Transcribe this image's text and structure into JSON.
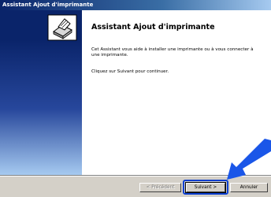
{
  "window": {
    "title": "Assistant Ajout d'imprimante"
  },
  "wizard": {
    "heading": "Assistant Ajout d'imprimante",
    "description": "Cet Assistant vous aide à installer une imprimante ou à vous connecter à une imprimante.",
    "instruction": "Cliquez sur Suivant pour continuer."
  },
  "buttons": {
    "back_label": "< Précédent",
    "next_label": "Suivant >",
    "cancel_label": "Annuler"
  },
  "icons": {
    "wizard_icon": "printer-icon",
    "pointer": "arrow-icon"
  },
  "colors": {
    "titlebar": "#0a246a",
    "highlight": "#0a3fd0",
    "arrow": "#1a56e8"
  }
}
